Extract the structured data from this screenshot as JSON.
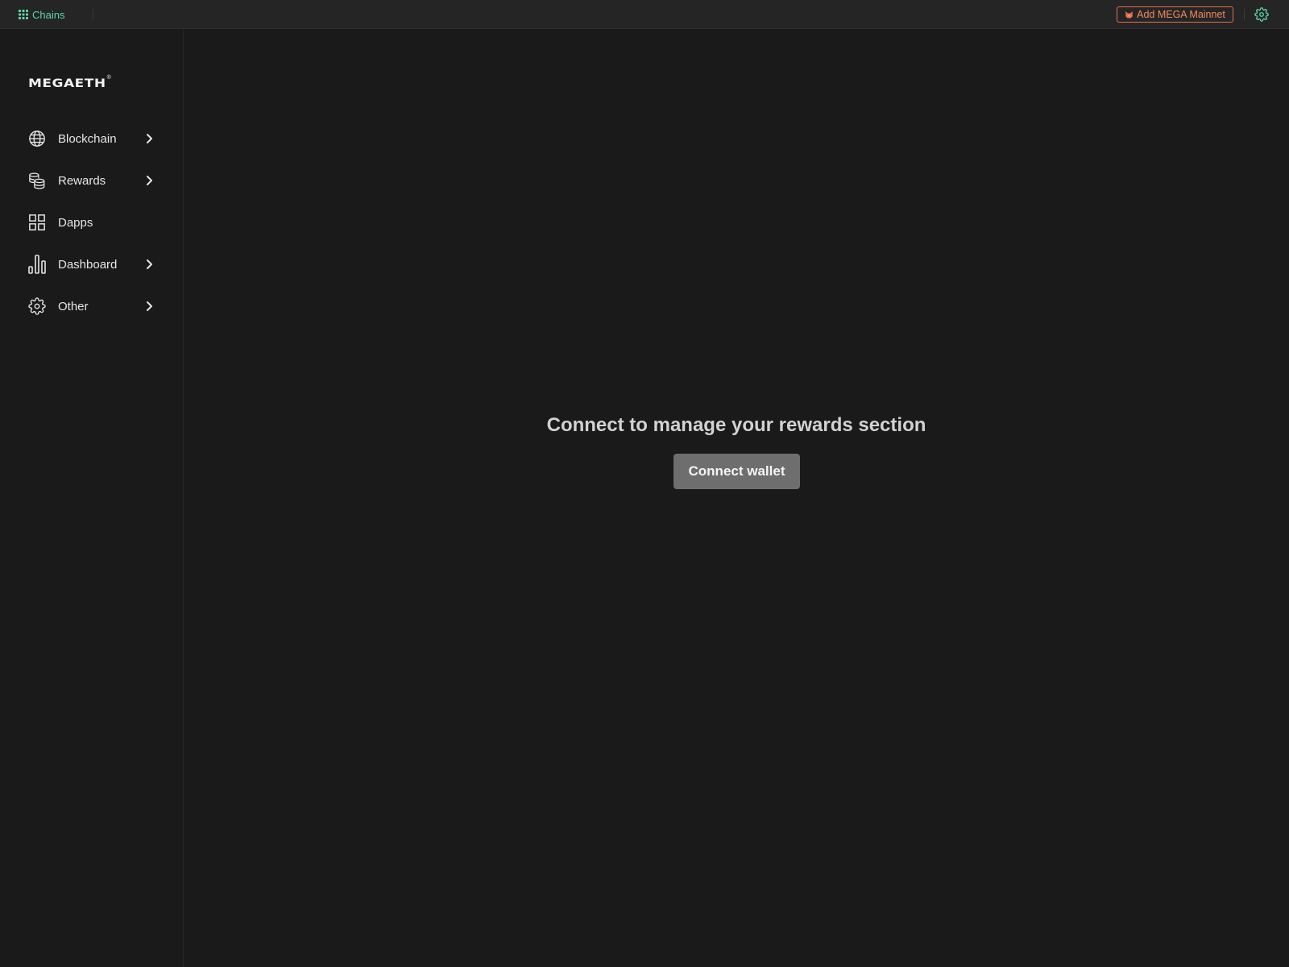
{
  "topbar": {
    "chains_label": "Chains",
    "add_network_label": "Add MEGA Mainnet",
    "accent_color": "#5ed4a4",
    "warning_color": "#e8704a"
  },
  "sidebar": {
    "logo_text": "MEGAETH",
    "logo_mark": "®",
    "items": [
      {
        "label": "Blockchain",
        "icon": "globe-icon",
        "has_submenu": true
      },
      {
        "label": "Rewards",
        "icon": "coins-icon",
        "has_submenu": true
      },
      {
        "label": "Dapps",
        "icon": "apps-grid-icon",
        "has_submenu": false
      },
      {
        "label": "Dashboard",
        "icon": "bar-chart-icon",
        "has_submenu": true
      },
      {
        "label": "Other",
        "icon": "gear-icon",
        "has_submenu": true
      }
    ]
  },
  "main": {
    "title": "Connect to manage your rewards section",
    "connect_button_label": "Connect wallet"
  }
}
